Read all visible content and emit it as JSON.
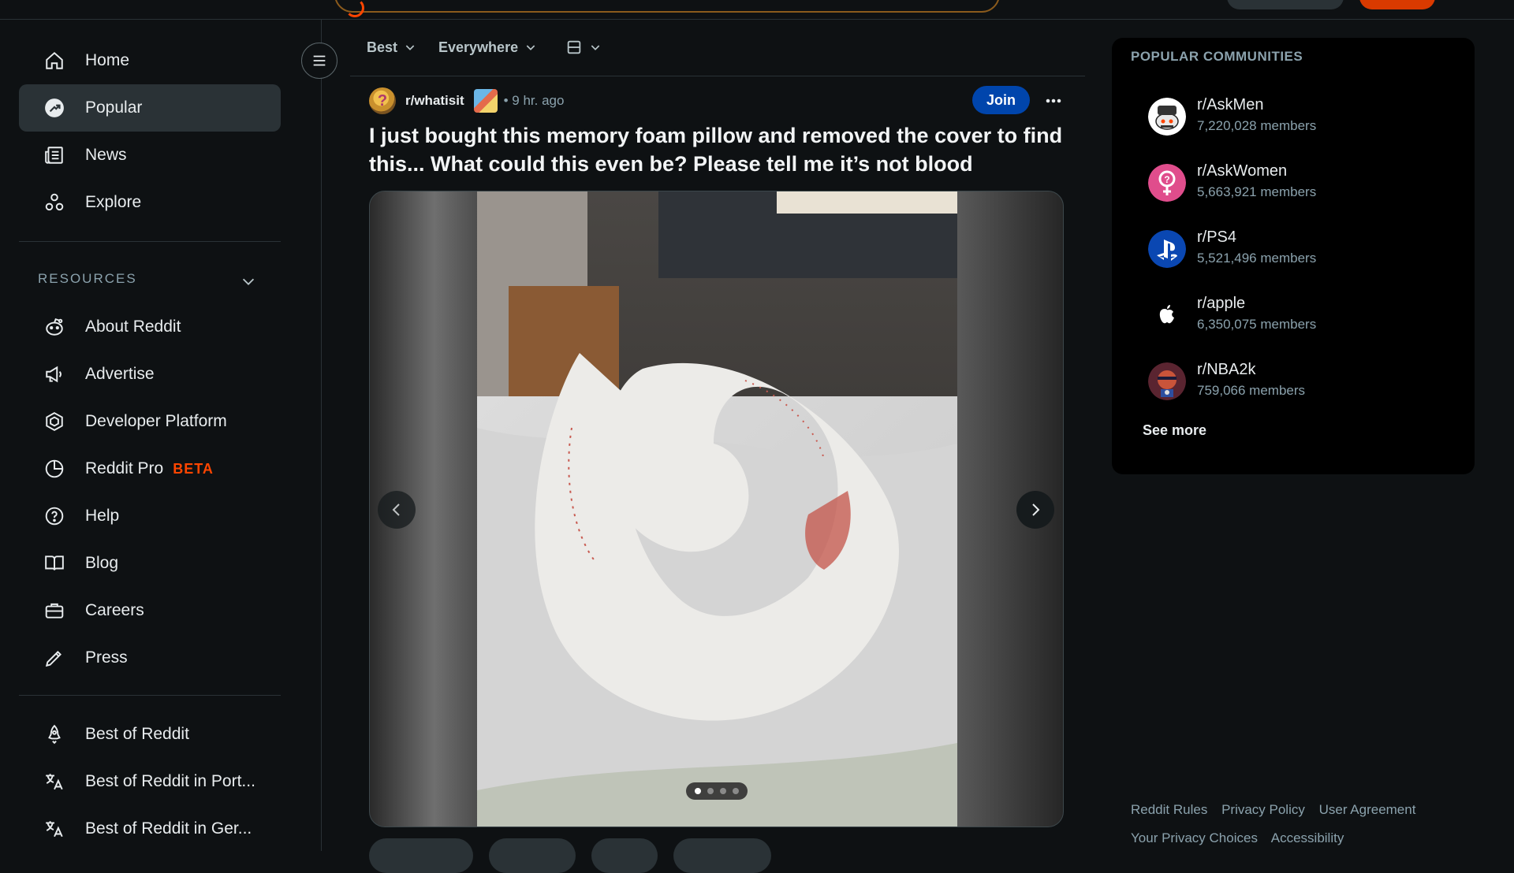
{
  "sidebar": {
    "primary": [
      {
        "label": "Home",
        "icon": "home-icon"
      },
      {
        "label": "Popular",
        "icon": "popular-icon"
      },
      {
        "label": "News",
        "icon": "news-icon"
      },
      {
        "label": "Explore",
        "icon": "explore-icon"
      }
    ],
    "resources_header": "RESOURCES",
    "resources": [
      {
        "label": "About Reddit",
        "icon": "reddit-alien-icon"
      },
      {
        "label": "Advertise",
        "icon": "megaphone-icon"
      },
      {
        "label": "Developer Platform",
        "icon": "developer-platform-icon"
      },
      {
        "label": "Reddit Pro",
        "icon": "pie-chart-icon",
        "badge": "BETA"
      },
      {
        "label": "Help",
        "icon": "help-icon"
      },
      {
        "label": "Blog",
        "icon": "book-icon"
      },
      {
        "label": "Careers",
        "icon": "briefcase-icon"
      },
      {
        "label": "Press",
        "icon": "pen-icon"
      }
    ],
    "more": [
      {
        "label": "Best of Reddit",
        "icon": "rocket-icon"
      },
      {
        "label": "Best of Reddit in Port...",
        "icon": "translate-icon"
      },
      {
        "label": "Best of Reddit in Ger...",
        "icon": "translate-icon"
      }
    ]
  },
  "feed": {
    "sort": {
      "best": "Best",
      "scope": "Everywhere",
      "view_icon": "card-view-icon"
    },
    "post": {
      "subreddit": "r/whatisit",
      "time": "• 9 hr. ago",
      "join_label": "Join",
      "title": "I just bought this memory foam pillow and removed the cover to find this... What could this even be? Please tell me it’s not blood",
      "gallery": {
        "count": 4,
        "current": 1
      }
    }
  },
  "popular_communities": {
    "title": "POPULAR COMMUNITIES",
    "items": [
      {
        "name": "r/AskMen",
        "members": "7,220,028 members",
        "icon": "askmen-avatar-icon"
      },
      {
        "name": "r/AskWomen",
        "members": "5,663,921 members",
        "icon": "askwomen-avatar-icon"
      },
      {
        "name": "r/PS4",
        "members": "5,521,496 members",
        "icon": "playstation-icon"
      },
      {
        "name": "r/apple",
        "members": "6,350,075 members",
        "icon": "apple-icon"
      },
      {
        "name": "r/NBA2k",
        "members": "759,066 members",
        "icon": "nba2k-avatar-icon"
      }
    ],
    "see_more": "See more"
  },
  "footer": {
    "row1": [
      "Reddit Rules",
      "Privacy Policy",
      "User Agreement"
    ],
    "row2": [
      "Your Privacy Choices",
      "Accessibility"
    ]
  },
  "colors": {
    "background": "#0e1113",
    "active_nav": "#2a3236",
    "join_button": "#0045ac",
    "beta_badge": "#ff4500",
    "muted_text": "#8ba2ad"
  }
}
